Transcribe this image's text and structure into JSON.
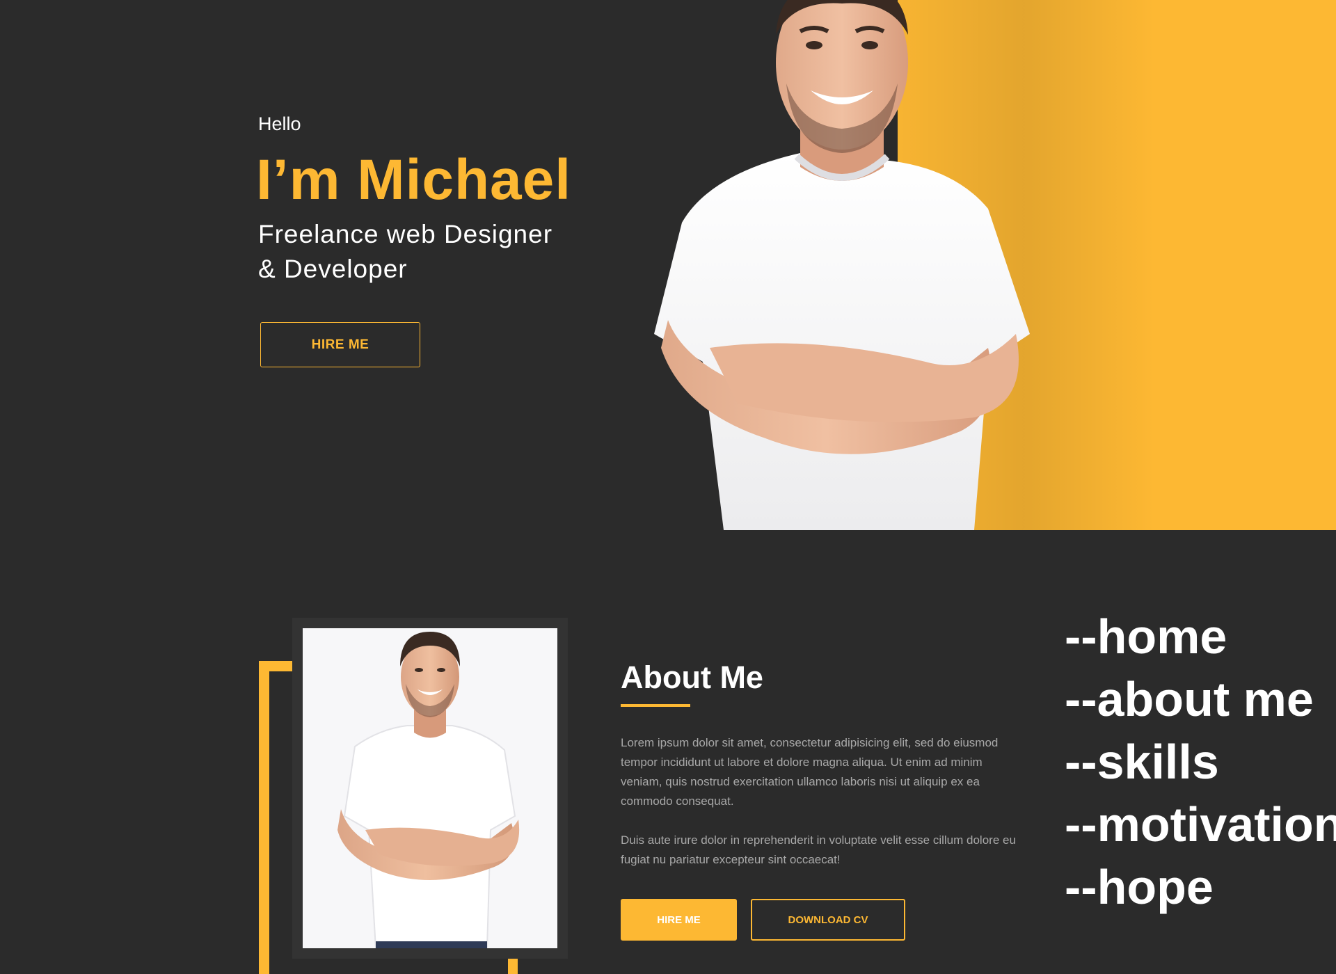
{
  "hero": {
    "greeting": "Hello",
    "name": "I’m Michael",
    "role_line1": "Freelance web Designer",
    "role_line2": "& Developer",
    "hire_button": "HIRE ME"
  },
  "about": {
    "title": "About Me",
    "paragraph1": "Lorem ipsum dolor sit amet, consectetur adipisicing elit, sed do eiusmod tempor incididunt ut labore et dolore magna aliqua. Ut enim ad minim veniam, quis nostrud exercitation ullamco laboris nisi ut aliquip ex ea commodo consequat.",
    "paragraph2": "Duis aute irure dolor in reprehenderit in voluptate velit esse cillum dolore eu fugiat nu pariatur excepteur sint occaecat!",
    "hire_button": "HIRE ME",
    "download_button": "DOWNLOAD CV"
  },
  "nav": {
    "items": [
      "--home",
      "--about me",
      "--skills",
      "--motivation",
      "--hope"
    ]
  },
  "colors": {
    "accent": "#fdb833",
    "background": "#2b2b2b",
    "text": "#ffffff",
    "muted_text": "#a8a8a8"
  },
  "icons": {
    "hero_photo": "person-photo",
    "about_photo": "person-photo"
  }
}
